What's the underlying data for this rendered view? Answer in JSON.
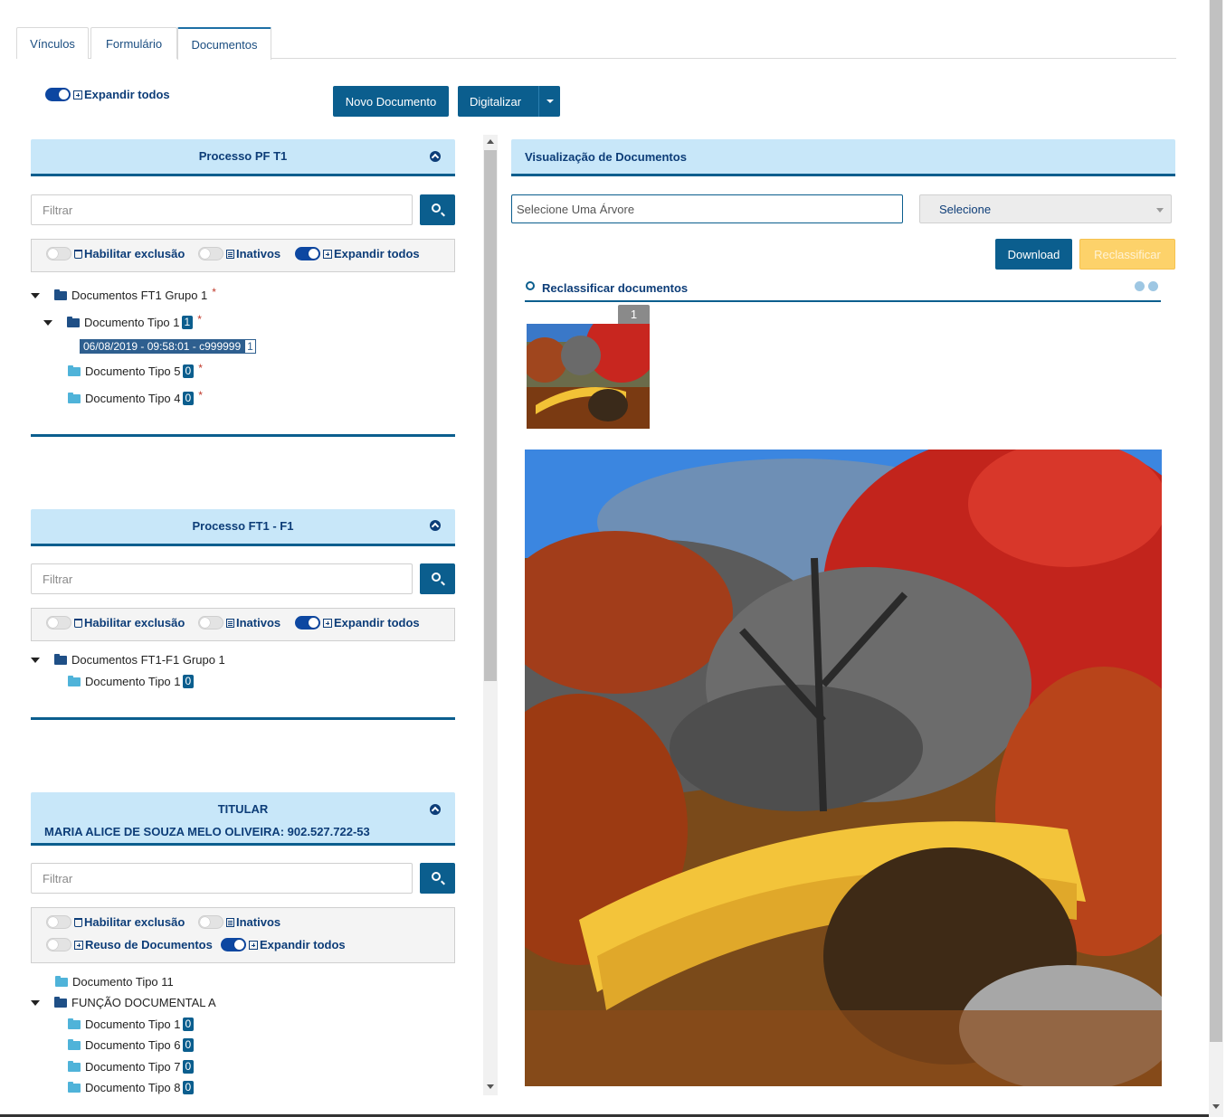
{
  "tabs": [
    {
      "label": "Vínculos",
      "active": false
    },
    {
      "label": "Formulário",
      "active": false
    },
    {
      "label": "Documentos",
      "active": true
    }
  ],
  "toolbar": {
    "expand_all_label": "Expandir todos",
    "new_doc_label": "Novo Documento",
    "scan_label": "Digitalizar"
  },
  "panels": [
    {
      "title": "Processo PF T1",
      "filter_placeholder": "Filtrar",
      "opt_delete": "Habilitar exclusão",
      "opt_inactive": "Inativos",
      "opt_expand": "Expandir todos",
      "tree": {
        "group": "Documentos FT1 Grupo 1",
        "type1": "Documento Tipo 1",
        "type1_count": "1",
        "selected_doc": "06/08/2019 - 09:58:01 - c999999",
        "selected_count": "1",
        "type5": "Documento Tipo 5",
        "type5_count": "0",
        "type4": "Documento Tipo 4",
        "type4_count": "0"
      }
    },
    {
      "title": "Processo FT1 - F1",
      "filter_placeholder": "Filtrar",
      "opt_delete": "Habilitar exclusão",
      "opt_inactive": "Inativos",
      "opt_expand": "Expandir todos",
      "tree": {
        "group": "Documentos FT1-F1 Grupo 1",
        "type1": "Documento Tipo 1",
        "type1_count": "0"
      }
    },
    {
      "title": "TITULAR",
      "subtitle": "MARIA ALICE DE SOUZA MELO OLIVEIRA: 902.527.722-53",
      "filter_placeholder": "Filtrar",
      "opt_delete": "Habilitar exclusão",
      "opt_inactive": "Inativos",
      "opt_reuse": "Reuso de Documentos",
      "opt_expand": "Expandir todos",
      "tree": {
        "type11": "Documento Tipo 11",
        "group": "FUNÇÃO DOCUMENTAL A",
        "type1": "Documento Tipo 1",
        "type1_count": "0",
        "type6": "Documento Tipo 6",
        "type6_count": "0",
        "type7": "Documento Tipo 7",
        "type7_count": "0",
        "type8": "Documento Tipo 8",
        "type8_count": "0"
      }
    }
  ],
  "viewer": {
    "title": "Visualização de Documentos",
    "tree_select_placeholder": "Selecione Uma Árvore",
    "select_label": "Selecione",
    "download_label": "Download",
    "reclassify_label": "Reclassificar",
    "reclassify_docs_label": "Reclassificar documentos",
    "thumb_page": "1"
  },
  "colors": {
    "primary": "#0b5e8e",
    "header_bg": "#c8e7f9",
    "reclassify_btn": "#fdd26a"
  }
}
